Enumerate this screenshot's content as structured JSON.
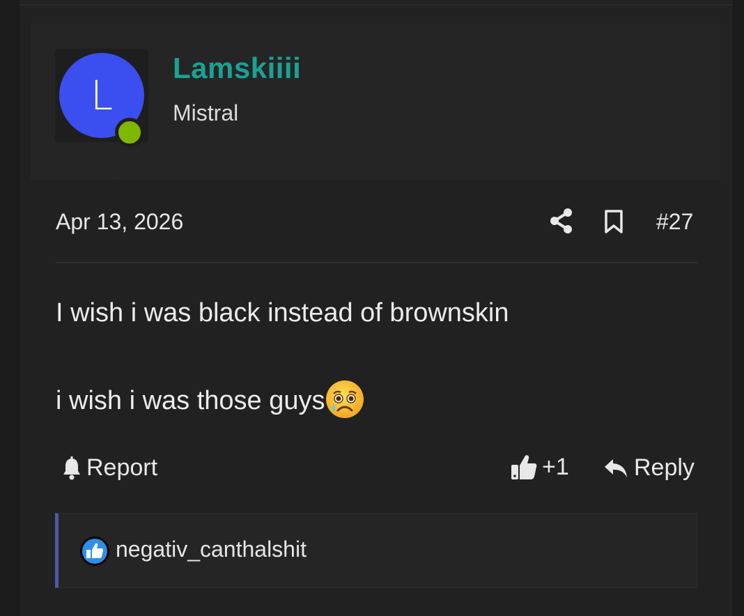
{
  "user": {
    "avatar_letter": "L",
    "username": "Lamskiiii",
    "title": "Mistral",
    "avatar_color": "#3b4ef0",
    "online_color": "#7fb700",
    "username_color": "#1aa193"
  },
  "post": {
    "date": "Apr 13, 2026",
    "number": "#27",
    "line1": "I wish i was black instead of brownskin",
    "line2": "i wish i was those guys",
    "emoji": "crying-sad-face-icon"
  },
  "actions": {
    "report_label": "Report",
    "like_count": "+1",
    "reply_label": "Reply"
  },
  "reactions": {
    "user": "negativ_canthalshit",
    "icon": "like-icon"
  }
}
